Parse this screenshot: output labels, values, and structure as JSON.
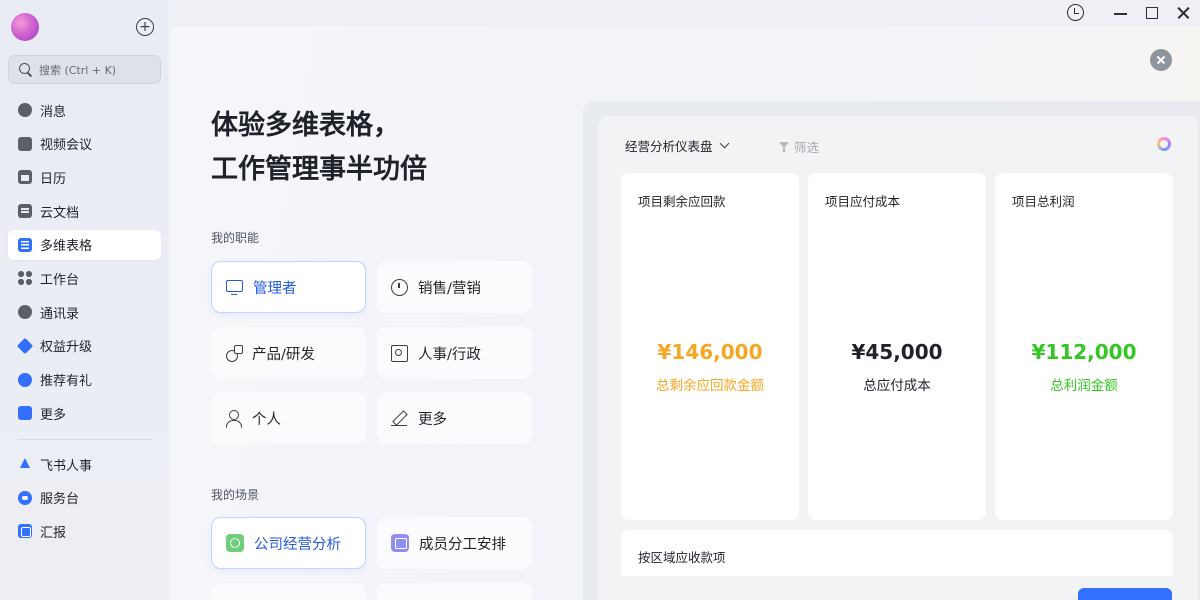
{
  "sidebar": {
    "search_placeholder": "搜索 (Ctrl + K)",
    "add_symbol": "+",
    "items": [
      {
        "label": "消息",
        "icon": "message-icon"
      },
      {
        "label": "视频会议",
        "icon": "video-icon"
      },
      {
        "label": "日历",
        "icon": "calendar-icon"
      },
      {
        "label": "云文档",
        "icon": "doc-icon"
      },
      {
        "label": "多维表格",
        "icon": "base-icon",
        "active": true
      },
      {
        "label": "工作台",
        "icon": "workplace-icon"
      },
      {
        "label": "通讯录",
        "icon": "contacts-icon"
      },
      {
        "label": "权益升级",
        "icon": "upgrade-icon"
      },
      {
        "label": "推荐有礼",
        "icon": "referral-icon"
      },
      {
        "label": "更多",
        "icon": "more-icon"
      }
    ],
    "apps": [
      {
        "label": "飞书人事",
        "icon": "hr-icon"
      },
      {
        "label": "服务台",
        "icon": "service-desk-icon"
      },
      {
        "label": "汇报",
        "icon": "report-icon"
      }
    ]
  },
  "window_controls": [
    "history-icon",
    "minimize-icon",
    "maximize-icon",
    "close-icon"
  ],
  "main": {
    "headline_line1": "体验多维表格，",
    "headline_line2": "工作管理事半功倍",
    "roles_label": "我的职能",
    "roles": [
      {
        "label": "管理者",
        "icon": "monitor-icon",
        "selected": true
      },
      {
        "label": "销售/营销",
        "icon": "timer-icon"
      },
      {
        "label": "产品/研发",
        "icon": "product-icon"
      },
      {
        "label": "人事/行政",
        "icon": "person-card-icon"
      },
      {
        "label": "个人",
        "icon": "person-icon"
      },
      {
        "label": "更多",
        "icon": "pen-icon"
      }
    ],
    "scenes_label": "我的场景",
    "scenes": [
      {
        "label": "公司经营分析",
        "icon": "analysis-icon",
        "selected": true
      },
      {
        "label": "成员分工安排",
        "icon": "schedule-icon"
      }
    ]
  },
  "dashboard": {
    "title": "经营分析仪表盘",
    "filter_label": "筛选",
    "cards": [
      {
        "title": "项目剩余应回款",
        "value": "¥146,000",
        "subtitle": "总剩余应回款金额",
        "color": "#f5a623"
      },
      {
        "title": "项目应付成本",
        "value": "¥45,000",
        "subtitle": "总应付成本",
        "color": "#1f2329"
      },
      {
        "title": "项目总利润",
        "value": "¥112,000",
        "subtitle": "总利润金额",
        "color": "#34c724"
      }
    ],
    "region_title": "按区域应收款项"
  }
}
